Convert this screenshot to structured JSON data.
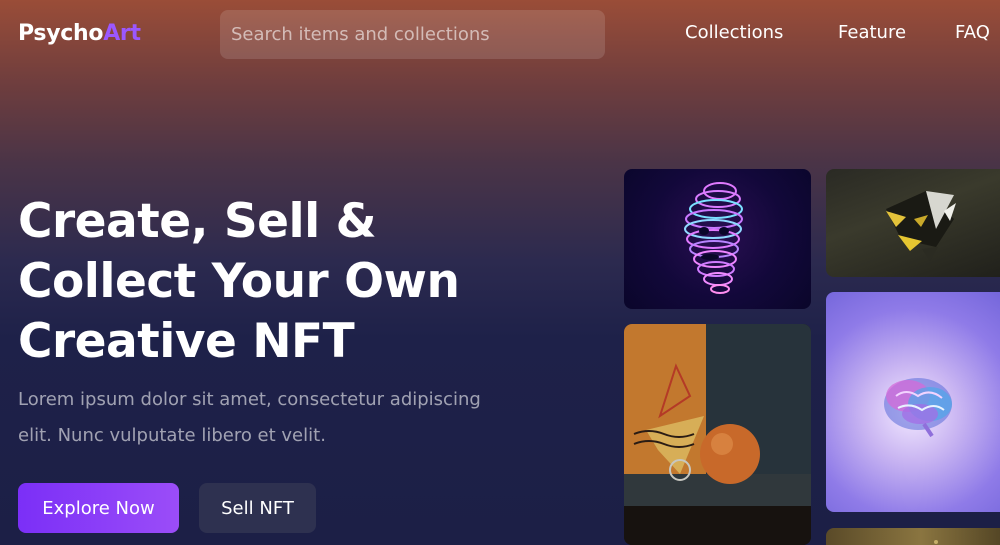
{
  "header": {
    "brand_main": "Psycho",
    "brand_accent": "Art",
    "search_placeholder": "Search items and collections",
    "nav": [
      "Collections",
      "Feature",
      "FAQ"
    ]
  },
  "hero": {
    "title_lines": [
      "Create, Sell &",
      "Collect Your Own",
      "Creative NFT"
    ],
    "description": "Lorem ipsum dolor sit amet, consectetur adipiscing elit. Nunc vulputate libero et velit.",
    "explore_label": "Explore Now",
    "sell_label": "Sell NFT"
  },
  "gallery": {
    "items": [
      "neon-head-artwork",
      "dark-polyhedron-artwork",
      "orange-sphere-artwork",
      "glowing-brain-artwork",
      "gold-artwork"
    ]
  },
  "colors": {
    "accent": "#9b57ff",
    "primary_button": "#7b2ff7",
    "secondary_button": "#2e3150"
  }
}
